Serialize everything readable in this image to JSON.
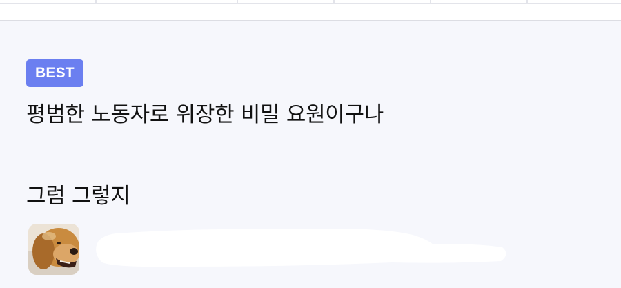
{
  "badge": {
    "label": "BEST"
  },
  "comment": {
    "line1": "평범한 노동자로 위장한 비밀 요원이구나",
    "line2": "그럼 그렇지"
  },
  "colors": {
    "badge_bg": "#6b7ff0",
    "page_bg": "#f6f7fc",
    "text": "#111111"
  },
  "avatar": {
    "icon": "dog-photo-icon"
  }
}
